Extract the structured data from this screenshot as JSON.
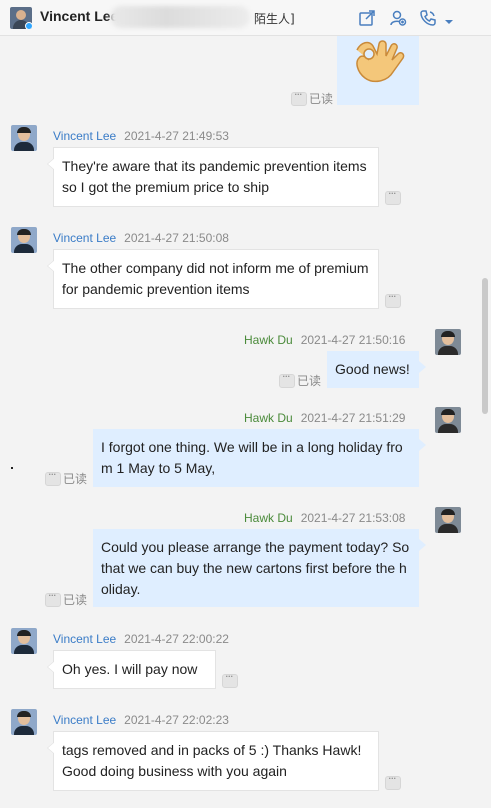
{
  "header": {
    "contact_name": "Vincent Lee",
    "contact_tag": "陌生人]",
    "icons": [
      "share-icon",
      "add-contact-icon",
      "call-icon",
      "chevron-down-icon"
    ]
  },
  "read_label": "已读",
  "messages": [
    {
      "sender": "Vincent Lee",
      "time": "2021-4-27 21:49:53",
      "text": "They're aware that its pandemic prevention items so I got the premium price to ship"
    },
    {
      "sender": "Vincent Lee",
      "time": "2021-4-27 21:50:08",
      "text": "The other company did not inform me of premium for pandemic prevention items"
    },
    {
      "sender": "Hawk Du",
      "time": "2021-4-27 21:50:16",
      "text": "Good news!"
    },
    {
      "sender": "Hawk Du",
      "time": "2021-4-27 21:51:29",
      "text": "I forgot one thing. We will be in a long holiday from 1 May to 5 May,"
    },
    {
      "sender": "Hawk Du",
      "time": "2021-4-27 21:53:08",
      "text": "Could you please arrange the payment today? So that we can buy the new cartons first before the holiday."
    },
    {
      "sender": "Vincent Lee",
      "time": "2021-4-27 22:00:22",
      "text": "Oh yes. I will pay now"
    },
    {
      "sender": "Vincent Lee",
      "time": "2021-4-27 22:02:23",
      "text": "tags removed and in packs of 5 :) Thanks Hawk! Good doing business with you again"
    }
  ]
}
